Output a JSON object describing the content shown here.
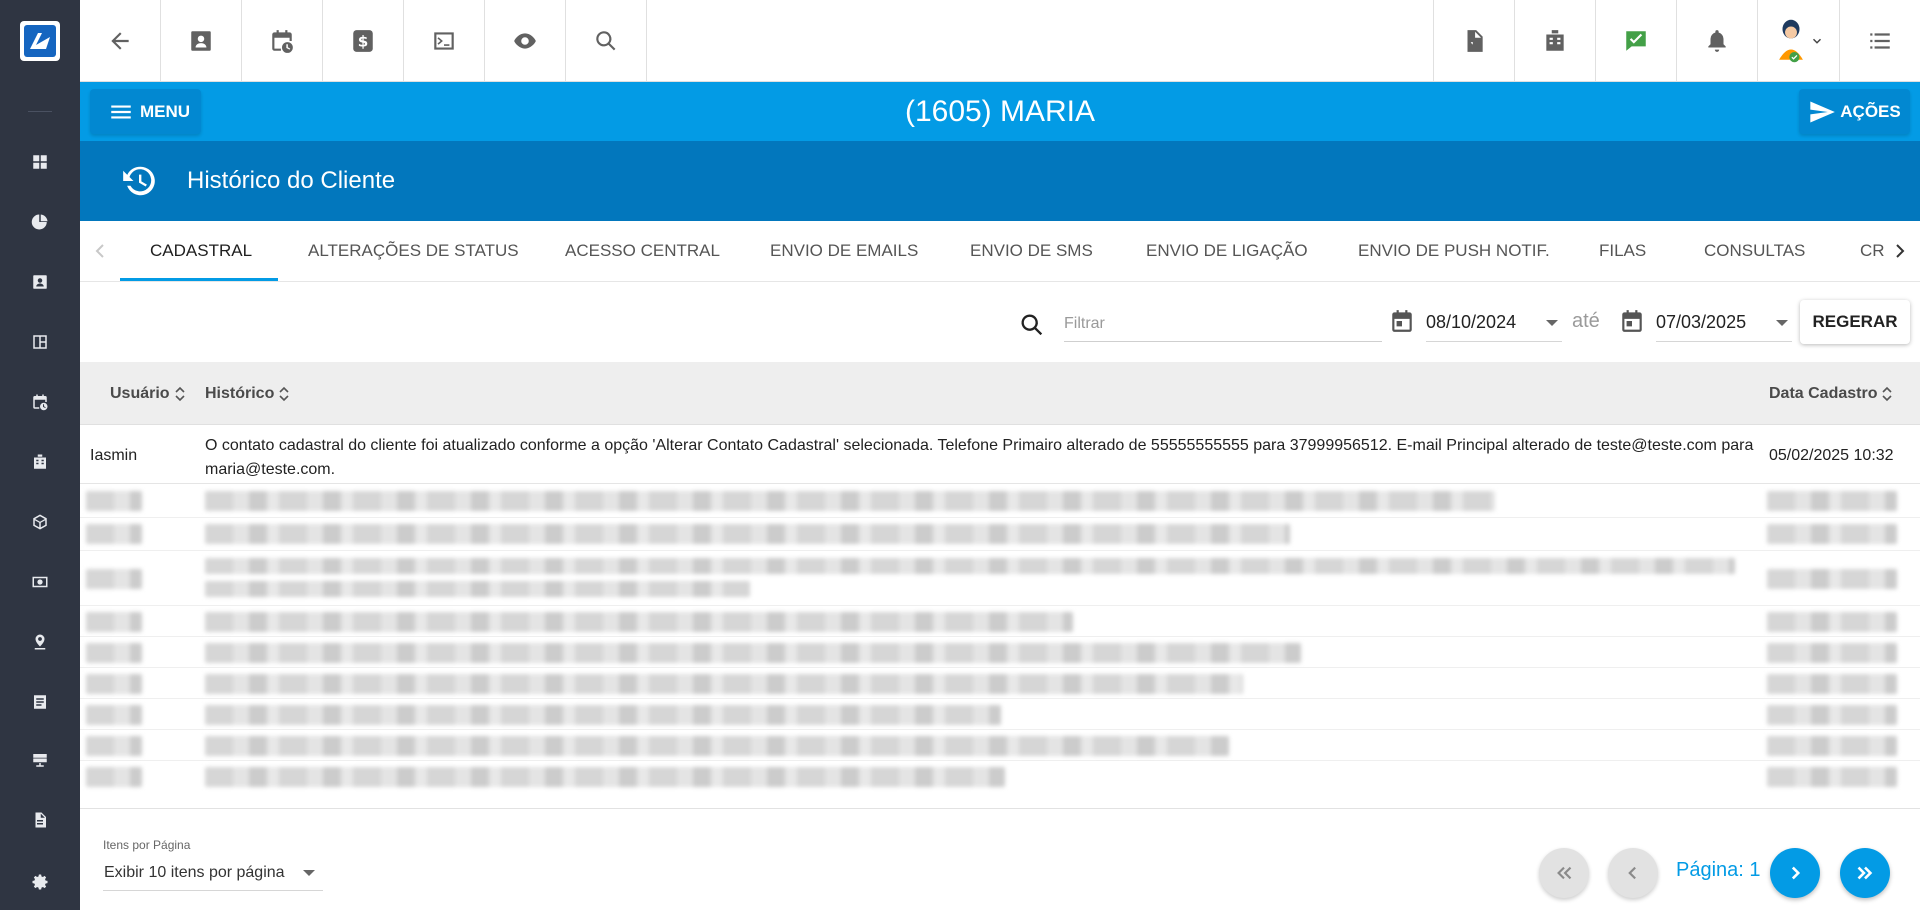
{
  "app": {
    "logo_icon": "app-logo-icon"
  },
  "sidebar": {
    "items": [
      {
        "icon": "dashboard-icon"
      },
      {
        "icon": "pie-chart-icon"
      },
      {
        "icon": "contact-card-icon"
      },
      {
        "icon": "layout-icon"
      },
      {
        "icon": "calendar-clock-icon"
      },
      {
        "icon": "building-icon"
      },
      {
        "icon": "box-icon"
      },
      {
        "icon": "money-icon"
      },
      {
        "icon": "map-pin-icon"
      },
      {
        "icon": "list-doc-icon"
      },
      {
        "icon": "server-icon"
      },
      {
        "icon": "document-icon"
      },
      {
        "icon": "gear-icon"
      }
    ]
  },
  "toolbar": {
    "left_icons": [
      "back-arrow-icon",
      "contact-card-icon",
      "calendar-clock-icon",
      "dollar-icon",
      "terminal-icon",
      "eye-icon",
      "search-icon"
    ],
    "right_icons": [
      "pdf-icon",
      "building-icon",
      "chat-check-icon",
      "bell-icon",
      "avatar",
      "list-icon"
    ]
  },
  "header": {
    "menu_label": "MENU",
    "title": "(1605) MARIA",
    "actions_label": "AÇÕES",
    "color": "#039be5"
  },
  "section": {
    "title": "Histórico do Cliente",
    "icon": "history-icon",
    "color": "#0277bd"
  },
  "tabs": [
    {
      "label": "CADASTRAL",
      "active": true
    },
    {
      "label": "ALTERAÇÕES DE STATUS"
    },
    {
      "label": "ACESSO CENTRAL"
    },
    {
      "label": "ENVIO DE EMAILS"
    },
    {
      "label": "ENVIO DE SMS"
    },
    {
      "label": "ENVIO DE LIGAÇÃO"
    },
    {
      "label": "ENVIO DE PUSH NOTIF."
    },
    {
      "label": "FILAS"
    },
    {
      "label": "CONSULTAS"
    },
    {
      "label": "CR"
    }
  ],
  "filters": {
    "search_placeholder": "Filtrar",
    "date_from": "08/10/2024",
    "between_label": "até",
    "date_to": "07/03/2025",
    "regenerate_label": "REGERAR"
  },
  "table": {
    "columns": [
      "Usuário",
      "Histórico",
      "Data Cadastro"
    ],
    "rows": [
      {
        "user": "Iasmin",
        "history": "O contato cadastral do cliente foi atualizado conforme a opção 'Alterar Contato Cadastral' selecionada. Telefone Primairo alterado de 55555555555 para 37999956512. E-mail Principal alterado de teste@teste.com para maria@teste.com.",
        "date": "05/02/2025 10:32"
      }
    ]
  },
  "pagination": {
    "items_per_page_label": "Itens por Página",
    "items_per_page_value": "Exibir 10 itens por página",
    "page_label": "Página: 1"
  }
}
